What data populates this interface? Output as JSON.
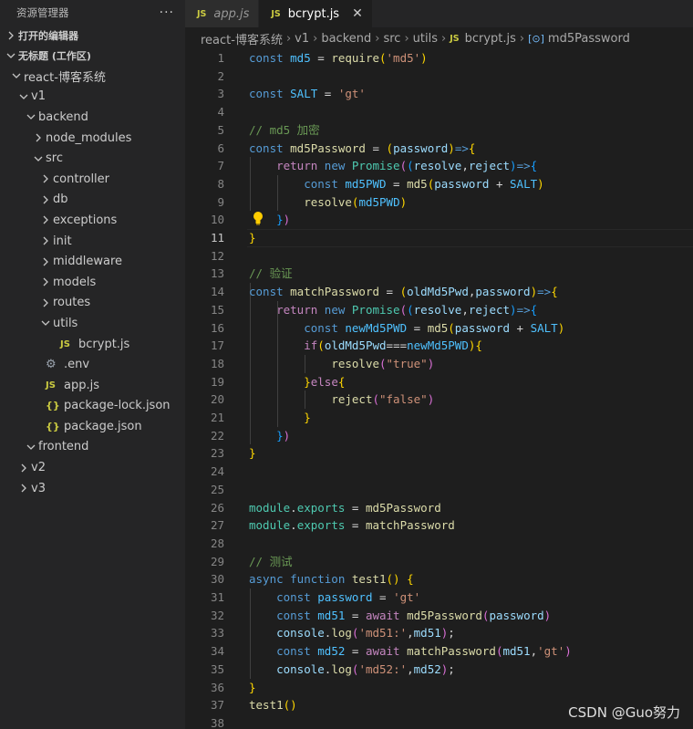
{
  "explorer": {
    "title": "资源管理器",
    "more": "···",
    "open_editors": "打开的编辑器",
    "workspace": "无标题 (工作区)",
    "tree": [
      {
        "depth": 1,
        "chev": "down",
        "icon": "",
        "label": "react-博客系统"
      },
      {
        "depth": 2,
        "chev": "down",
        "icon": "",
        "label": "v1"
      },
      {
        "depth": 3,
        "chev": "down",
        "icon": "",
        "label": "backend"
      },
      {
        "depth": 4,
        "chev": "right",
        "icon": "",
        "label": "node_modules"
      },
      {
        "depth": 4,
        "chev": "down",
        "icon": "",
        "label": "src"
      },
      {
        "depth": 5,
        "chev": "right",
        "icon": "",
        "label": "controller"
      },
      {
        "depth": 5,
        "chev": "right",
        "icon": "",
        "label": "db"
      },
      {
        "depth": 5,
        "chev": "right",
        "icon": "",
        "label": "exceptions"
      },
      {
        "depth": 5,
        "chev": "right",
        "icon": "",
        "label": "init"
      },
      {
        "depth": 5,
        "chev": "right",
        "icon": "",
        "label": "middleware"
      },
      {
        "depth": 5,
        "chev": "right",
        "icon": "",
        "label": "models"
      },
      {
        "depth": 5,
        "chev": "right",
        "icon": "",
        "label": "routes"
      },
      {
        "depth": 5,
        "chev": "down",
        "icon": "",
        "label": "utils"
      },
      {
        "depth": 6,
        "chev": "",
        "icon": "JS",
        "label": "bcrypt.js"
      },
      {
        "depth": 4,
        "chev": "",
        "icon": "gear",
        "label": ".env"
      },
      {
        "depth": 4,
        "chev": "",
        "icon": "JS",
        "label": "app.js"
      },
      {
        "depth": 4,
        "chev": "",
        "icon": "{}",
        "label": "package-lock.json"
      },
      {
        "depth": 4,
        "chev": "",
        "icon": "{}",
        "label": "package.json"
      },
      {
        "depth": 3,
        "chev": "down",
        "icon": "",
        "label": "frontend"
      },
      {
        "depth": 2,
        "chev": "right",
        "icon": "",
        "label": "v2"
      },
      {
        "depth": 2,
        "chev": "right",
        "icon": "",
        "label": "v3"
      }
    ]
  },
  "tabs": [
    {
      "badge": "JS",
      "label": "app.js",
      "active": false
    },
    {
      "badge": "JS",
      "label": "bcrypt.js",
      "active": true,
      "close": "✕"
    }
  ],
  "breadcrumb": [
    "react-博客系统",
    "v1",
    "backend",
    "src",
    "utils"
  ],
  "breadcrumb_file": "bcrypt.js",
  "breadcrumb_file_badge": "JS",
  "breadcrumb_symbol_icon": "[⊙]",
  "breadcrumb_symbol": "md5Password",
  "editor": {
    "current_line": 11,
    "lightbulb_line": 10,
    "lines": [
      [
        [
          "k",
          "const "
        ],
        [
          "c",
          "md5"
        ],
        [
          "o",
          " = "
        ],
        [
          "f",
          "require"
        ],
        [
          "b1",
          "("
        ],
        [
          "s",
          "'md5'"
        ],
        [
          "b1",
          ")"
        ]
      ],
      [],
      [
        [
          "k",
          "const "
        ],
        [
          "c",
          "SALT"
        ],
        [
          "o",
          " = "
        ],
        [
          "s",
          "'gt'"
        ]
      ],
      [],
      [
        [
          "cm",
          "// md5 加密"
        ]
      ],
      [
        [
          "k",
          "const "
        ],
        [
          "f",
          "md5Password"
        ],
        [
          "o",
          " = "
        ],
        [
          "b1",
          "("
        ],
        [
          "v",
          "password"
        ],
        [
          "b1",
          ")"
        ],
        [
          "k",
          "=>"
        ],
        [
          "b1",
          "{"
        ]
      ],
      [
        [
          "o",
          "    "
        ],
        [
          "p",
          "return "
        ],
        [
          "k",
          "new "
        ],
        [
          "t",
          "Promise"
        ],
        [
          "b2",
          "("
        ],
        [
          "b3",
          "("
        ],
        [
          "v",
          "resolve"
        ],
        [
          "o",
          ","
        ],
        [
          "v",
          "reject"
        ],
        [
          "b3",
          ")"
        ],
        [
          "k",
          "=>"
        ],
        [
          "b3",
          "{"
        ]
      ],
      [
        [
          "o",
          "        "
        ],
        [
          "k",
          "const "
        ],
        [
          "c",
          "md5PWD"
        ],
        [
          "o",
          " = "
        ],
        [
          "f",
          "md5"
        ],
        [
          "b1",
          "("
        ],
        [
          "v",
          "password"
        ],
        [
          "o",
          " + "
        ],
        [
          "c",
          "SALT"
        ],
        [
          "b1",
          ")"
        ]
      ],
      [
        [
          "o",
          "        "
        ],
        [
          "f",
          "resolve"
        ],
        [
          "b1",
          "("
        ],
        [
          "c",
          "md5PWD"
        ],
        [
          "b1",
          ")"
        ]
      ],
      [
        [
          "o",
          "    "
        ],
        [
          "b3",
          "}"
        ],
        [
          "b2",
          ")"
        ]
      ],
      [
        [
          "b1",
          "}"
        ]
      ],
      [],
      [
        [
          "cm",
          "// 验证"
        ]
      ],
      [
        [
          "k",
          "const "
        ],
        [
          "f",
          "matchPassword"
        ],
        [
          "o",
          " = "
        ],
        [
          "b1",
          "("
        ],
        [
          "v",
          "oldMd5Pwd"
        ],
        [
          "o",
          ","
        ],
        [
          "v",
          "password"
        ],
        [
          "b1",
          ")"
        ],
        [
          "k",
          "=>"
        ],
        [
          "b1",
          "{"
        ]
      ],
      [
        [
          "o",
          "    "
        ],
        [
          "p",
          "return "
        ],
        [
          "k",
          "new "
        ],
        [
          "t",
          "Promise"
        ],
        [
          "b2",
          "("
        ],
        [
          "b3",
          "("
        ],
        [
          "v",
          "resolve"
        ],
        [
          "o",
          ","
        ],
        [
          "v",
          "reject"
        ],
        [
          "b3",
          ")"
        ],
        [
          "k",
          "=>"
        ],
        [
          "b3",
          "{"
        ]
      ],
      [
        [
          "o",
          "        "
        ],
        [
          "k",
          "const "
        ],
        [
          "c",
          "newMd5PWD"
        ],
        [
          "o",
          " = "
        ],
        [
          "f",
          "md5"
        ],
        [
          "b1",
          "("
        ],
        [
          "v",
          "password"
        ],
        [
          "o",
          " + "
        ],
        [
          "c",
          "SALT"
        ],
        [
          "b1",
          ")"
        ]
      ],
      [
        [
          "o",
          "        "
        ],
        [
          "p",
          "if"
        ],
        [
          "b1",
          "("
        ],
        [
          "v",
          "oldMd5Pwd"
        ],
        [
          "o",
          "==="
        ],
        [
          "c",
          "newMd5PWD"
        ],
        [
          "b1",
          ")"
        ],
        [
          "b1",
          "{"
        ]
      ],
      [
        [
          "o",
          "            "
        ],
        [
          "f",
          "resolve"
        ],
        [
          "b2",
          "("
        ],
        [
          "s",
          "\"true\""
        ],
        [
          "b2",
          ")"
        ]
      ],
      [
        [
          "o",
          "        "
        ],
        [
          "b1",
          "}"
        ],
        [
          "p",
          "else"
        ],
        [
          "b1",
          "{"
        ]
      ],
      [
        [
          "o",
          "            "
        ],
        [
          "f",
          "reject"
        ],
        [
          "b2",
          "("
        ],
        [
          "s",
          "\"false\""
        ],
        [
          "b2",
          ")"
        ]
      ],
      [
        [
          "o",
          "        "
        ],
        [
          "b1",
          "}"
        ]
      ],
      [
        [
          "o",
          "    "
        ],
        [
          "b3",
          "}"
        ],
        [
          "b2",
          ")"
        ]
      ],
      [
        [
          "b1",
          "}"
        ]
      ],
      [],
      [],
      [
        [
          "t",
          "module"
        ],
        [
          "o",
          "."
        ],
        [
          "t",
          "exports"
        ],
        [
          "o",
          " = "
        ],
        [
          "f",
          "md5Password"
        ]
      ],
      [
        [
          "t",
          "module"
        ],
        [
          "o",
          "."
        ],
        [
          "t",
          "exports"
        ],
        [
          "o",
          " = "
        ],
        [
          "f",
          "matchPassword"
        ]
      ],
      [],
      [
        [
          "cm",
          "// 测试"
        ]
      ],
      [
        [
          "k",
          "async "
        ],
        [
          "k",
          "function "
        ],
        [
          "f",
          "test1"
        ],
        [
          "b1",
          "()"
        ],
        [
          "o",
          " "
        ],
        [
          "b1",
          "{"
        ]
      ],
      [
        [
          "o",
          "    "
        ],
        [
          "k",
          "const "
        ],
        [
          "c",
          "password"
        ],
        [
          "o",
          " = "
        ],
        [
          "s",
          "'gt'"
        ]
      ],
      [
        [
          "o",
          "    "
        ],
        [
          "k",
          "const "
        ],
        [
          "c",
          "md51"
        ],
        [
          "o",
          " = "
        ],
        [
          "p",
          "await "
        ],
        [
          "f",
          "md5Password"
        ],
        [
          "b2",
          "("
        ],
        [
          "v",
          "password"
        ],
        [
          "b2",
          ")"
        ]
      ],
      [
        [
          "o",
          "    "
        ],
        [
          "v",
          "console"
        ],
        [
          "o",
          "."
        ],
        [
          "f",
          "log"
        ],
        [
          "b2",
          "("
        ],
        [
          "s",
          "'md51:'"
        ],
        [
          "o",
          ","
        ],
        [
          "v",
          "md51"
        ],
        [
          "b2",
          ")"
        ],
        [
          "o",
          ";"
        ]
      ],
      [
        [
          "o",
          "    "
        ],
        [
          "k",
          "const "
        ],
        [
          "c",
          "md52"
        ],
        [
          "o",
          " = "
        ],
        [
          "p",
          "await "
        ],
        [
          "f",
          "matchPassword"
        ],
        [
          "b2",
          "("
        ],
        [
          "v",
          "md51"
        ],
        [
          "o",
          ","
        ],
        [
          "s",
          "'gt'"
        ],
        [
          "b2",
          ")"
        ]
      ],
      [
        [
          "o",
          "    "
        ],
        [
          "v",
          "console"
        ],
        [
          "o",
          "."
        ],
        [
          "f",
          "log"
        ],
        [
          "b2",
          "("
        ],
        [
          "s",
          "'md52:'"
        ],
        [
          "o",
          ","
        ],
        [
          "v",
          "md52"
        ],
        [
          "b2",
          ")"
        ],
        [
          "o",
          ";"
        ]
      ],
      [
        [
          "b1",
          "}"
        ]
      ],
      [
        [
          "f",
          "test1"
        ],
        [
          "b1",
          "()"
        ]
      ],
      []
    ]
  },
  "watermark": "CSDN @Guo努力"
}
